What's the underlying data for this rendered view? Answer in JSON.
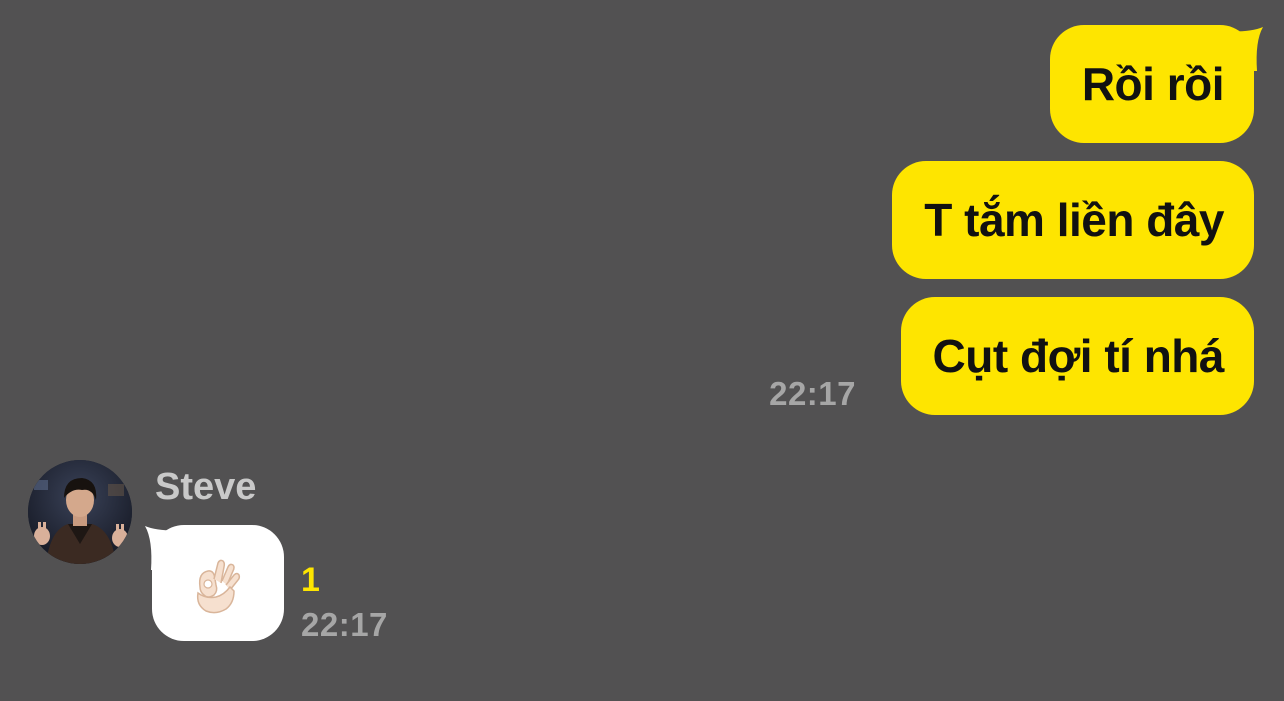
{
  "theme": {
    "background": "#525152",
    "outgoing_bubble": "#FEE500",
    "incoming_bubble": "#FFFFFF",
    "timestamp_color": "#A6A6A6",
    "unread_color": "#FEE500"
  },
  "outgoing": {
    "messages": [
      {
        "text": "Rồi rồi"
      },
      {
        "text": "T tắm liền đây"
      },
      {
        "text": "Cụt đợi tí nhá"
      }
    ],
    "time": "22:17"
  },
  "incoming": {
    "sender": "Steve",
    "avatar_icon": "profile-photo",
    "message_icon": "ok-hand-emoji",
    "unread_count": "1",
    "time": "22:17"
  }
}
